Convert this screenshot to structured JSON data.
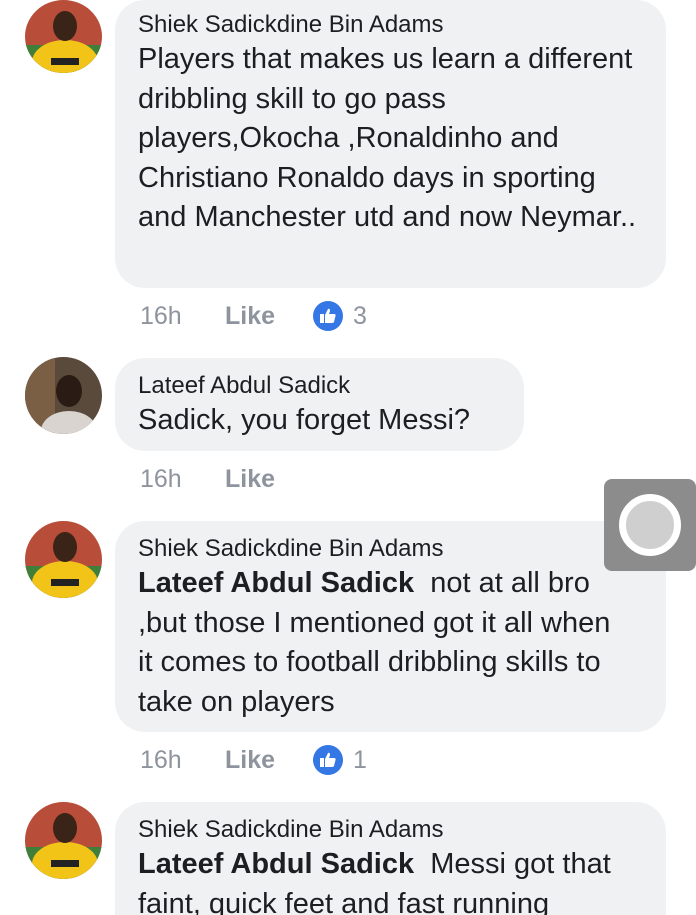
{
  "comments": [
    {
      "author": "Shiek Sadickdine Bin Adams",
      "mention": "",
      "text": "Players that makes us learn a different dribbling skill to go pass players,Okocha ,Ronaldinho and Christiano Ronaldo days in sporting and Manchester utd and now Neymar..",
      "time": "16h",
      "like_label": "Like",
      "reactions": "3"
    },
    {
      "author": "Lateef Abdul Sadick",
      "mention": "",
      "text": "Sadick, you forget Messi?",
      "time": "16h",
      "like_label": "Like",
      "reactions": ""
    },
    {
      "author": "Shiek Sadickdine Bin Adams",
      "mention": "Lateef Abdul Sadick",
      "text": "not at all bro ,but those I mentioned got it all when it comes to football dribbling skills to take on players",
      "time": "16h",
      "like_label": "Like",
      "reactions": "1"
    },
    {
      "author": "Shiek Sadickdine Bin Adams",
      "mention": "Lateef Abdul Sadick",
      "text": "Messi got that faint, quick feet and fast running",
      "time": "",
      "like_label": "",
      "reactions": ""
    }
  ],
  "icons": {
    "reaction": "like-thumb-icon",
    "floating_button": "chat-head-circle-icon"
  },
  "colors": {
    "bubble_bg": "#f0f1f3",
    "like_badge": "#3578e5",
    "meta_text": "#8d949e"
  }
}
